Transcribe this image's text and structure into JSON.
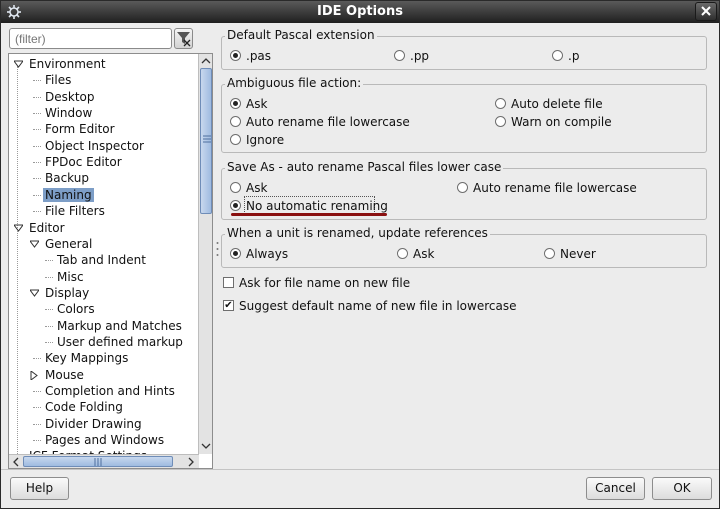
{
  "window": {
    "title": "IDE Options"
  },
  "filter": {
    "placeholder": "(filter)"
  },
  "tree": {
    "items": [
      {
        "label": "Environment",
        "level": 0,
        "expander": "expanded"
      },
      {
        "label": "Files",
        "level": 1
      },
      {
        "label": "Desktop",
        "level": 1
      },
      {
        "label": "Window",
        "level": 1
      },
      {
        "label": "Form Editor",
        "level": 1
      },
      {
        "label": "Object Inspector",
        "level": 1
      },
      {
        "label": "FPDoc Editor",
        "level": 1
      },
      {
        "label": "Backup",
        "level": 1
      },
      {
        "label": "Naming",
        "level": 1,
        "selected": true
      },
      {
        "label": "File Filters",
        "level": 1
      },
      {
        "label": "Editor",
        "level": 0,
        "expander": "expanded"
      },
      {
        "label": "General",
        "level": 1,
        "expander": "expanded"
      },
      {
        "label": "Tab and Indent",
        "level": 2
      },
      {
        "label": "Misc",
        "level": 2
      },
      {
        "label": "Display",
        "level": 1,
        "expander": "expanded"
      },
      {
        "label": "Colors",
        "level": 2
      },
      {
        "label": "Markup and Matches",
        "level": 2
      },
      {
        "label": "User defined markup",
        "level": 2
      },
      {
        "label": "Key Mappings",
        "level": 1
      },
      {
        "label": "Mouse",
        "level": 1,
        "expander": "collapsed"
      },
      {
        "label": "Completion and Hints",
        "level": 1
      },
      {
        "label": "Code Folding",
        "level": 1
      },
      {
        "label": "Divider Drawing",
        "level": 1
      },
      {
        "label": "Pages and Windows",
        "level": 1
      },
      {
        "label": "ICF Format Settings",
        "level": 0
      }
    ]
  },
  "groups": {
    "pascal_ext": {
      "title": "Default Pascal extension",
      "options": [
        {
          "label": ".pas",
          "checked": true
        },
        {
          "label": ".pp",
          "checked": false
        },
        {
          "label": ".p",
          "checked": false
        }
      ]
    },
    "ambiguous": {
      "title": "Ambiguous file action:",
      "options": [
        {
          "label": "Ask",
          "checked": true
        },
        {
          "label": "Auto delete file",
          "checked": false
        },
        {
          "label": "Auto rename file lowercase",
          "checked": false
        },
        {
          "label": "Warn on compile",
          "checked": false
        },
        {
          "label": "Ignore",
          "checked": false
        }
      ]
    },
    "save_as": {
      "title": "Save As - auto rename Pascal files lower case",
      "options": [
        {
          "label": "Ask",
          "checked": false
        },
        {
          "label": "Auto rename file lowercase",
          "checked": false
        },
        {
          "label": "No automatic renaming",
          "checked": true
        }
      ]
    },
    "unit_renamed": {
      "title": "When a unit is renamed, update references",
      "options": [
        {
          "label": "Always",
          "checked": true
        },
        {
          "label": "Ask",
          "checked": false
        },
        {
          "label": "Never",
          "checked": false
        }
      ]
    }
  },
  "checkboxes": [
    {
      "label": "Ask for file name on new file",
      "checked": false
    },
    {
      "label": "Suggest default name of new file in lowercase",
      "checked": true
    }
  ],
  "buttons": {
    "help": "Help",
    "cancel": "Cancel",
    "ok": "OK"
  },
  "colors": {
    "selection": "#7d9ec7",
    "annotation_underline": "#8a1010"
  }
}
